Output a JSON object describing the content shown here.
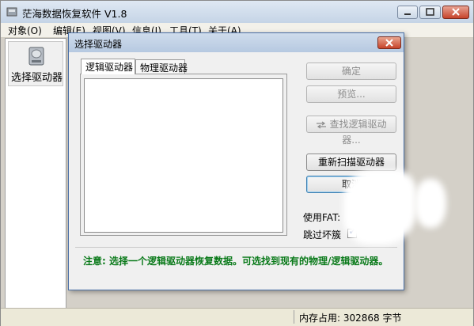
{
  "app": {
    "title": "茫海数据恢复软件 V1.8",
    "icon": "app-icon"
  },
  "window_controls": [
    "minimize-icon",
    "maximize-icon",
    "close-icon"
  ],
  "menu": [
    {
      "label": "对象(O)"
    },
    {
      "label": "编辑(E)"
    },
    {
      "label": "视图(V)"
    },
    {
      "label": "信息(I)"
    },
    {
      "label": "工具(T)"
    },
    {
      "label": "关于(A)"
    }
  ],
  "sidebar": {
    "tool_label": "选择驱动器",
    "tool_icon": "hard-drive-icon"
  },
  "status": {
    "memory": "内存占用: 302868 字节"
  },
  "dialog": {
    "title": "选择驱动器",
    "tabs": [
      {
        "label": "逻辑驱动器",
        "selected": true
      },
      {
        "label": "物理驱动器",
        "selected": false
      }
    ],
    "buttons": {
      "ok": "确定",
      "preview": "预览...",
      "find_logical": "查找逻辑驱动器...",
      "rescan": "重新扫描驱动器",
      "cancel": "取消"
    },
    "fat_label": "使用FAT:",
    "skip_bad_label": "跳过坏簇",
    "skip_bad_checked": true,
    "note": "注意: 选择一个逻辑驱动器恢复数据。可选找到现有的物理/逻辑驱动器。"
  },
  "colors": {
    "note_text": "#0a7a1a",
    "titlebar": "#c5d4e6",
    "close_button": "#c7432a"
  }
}
